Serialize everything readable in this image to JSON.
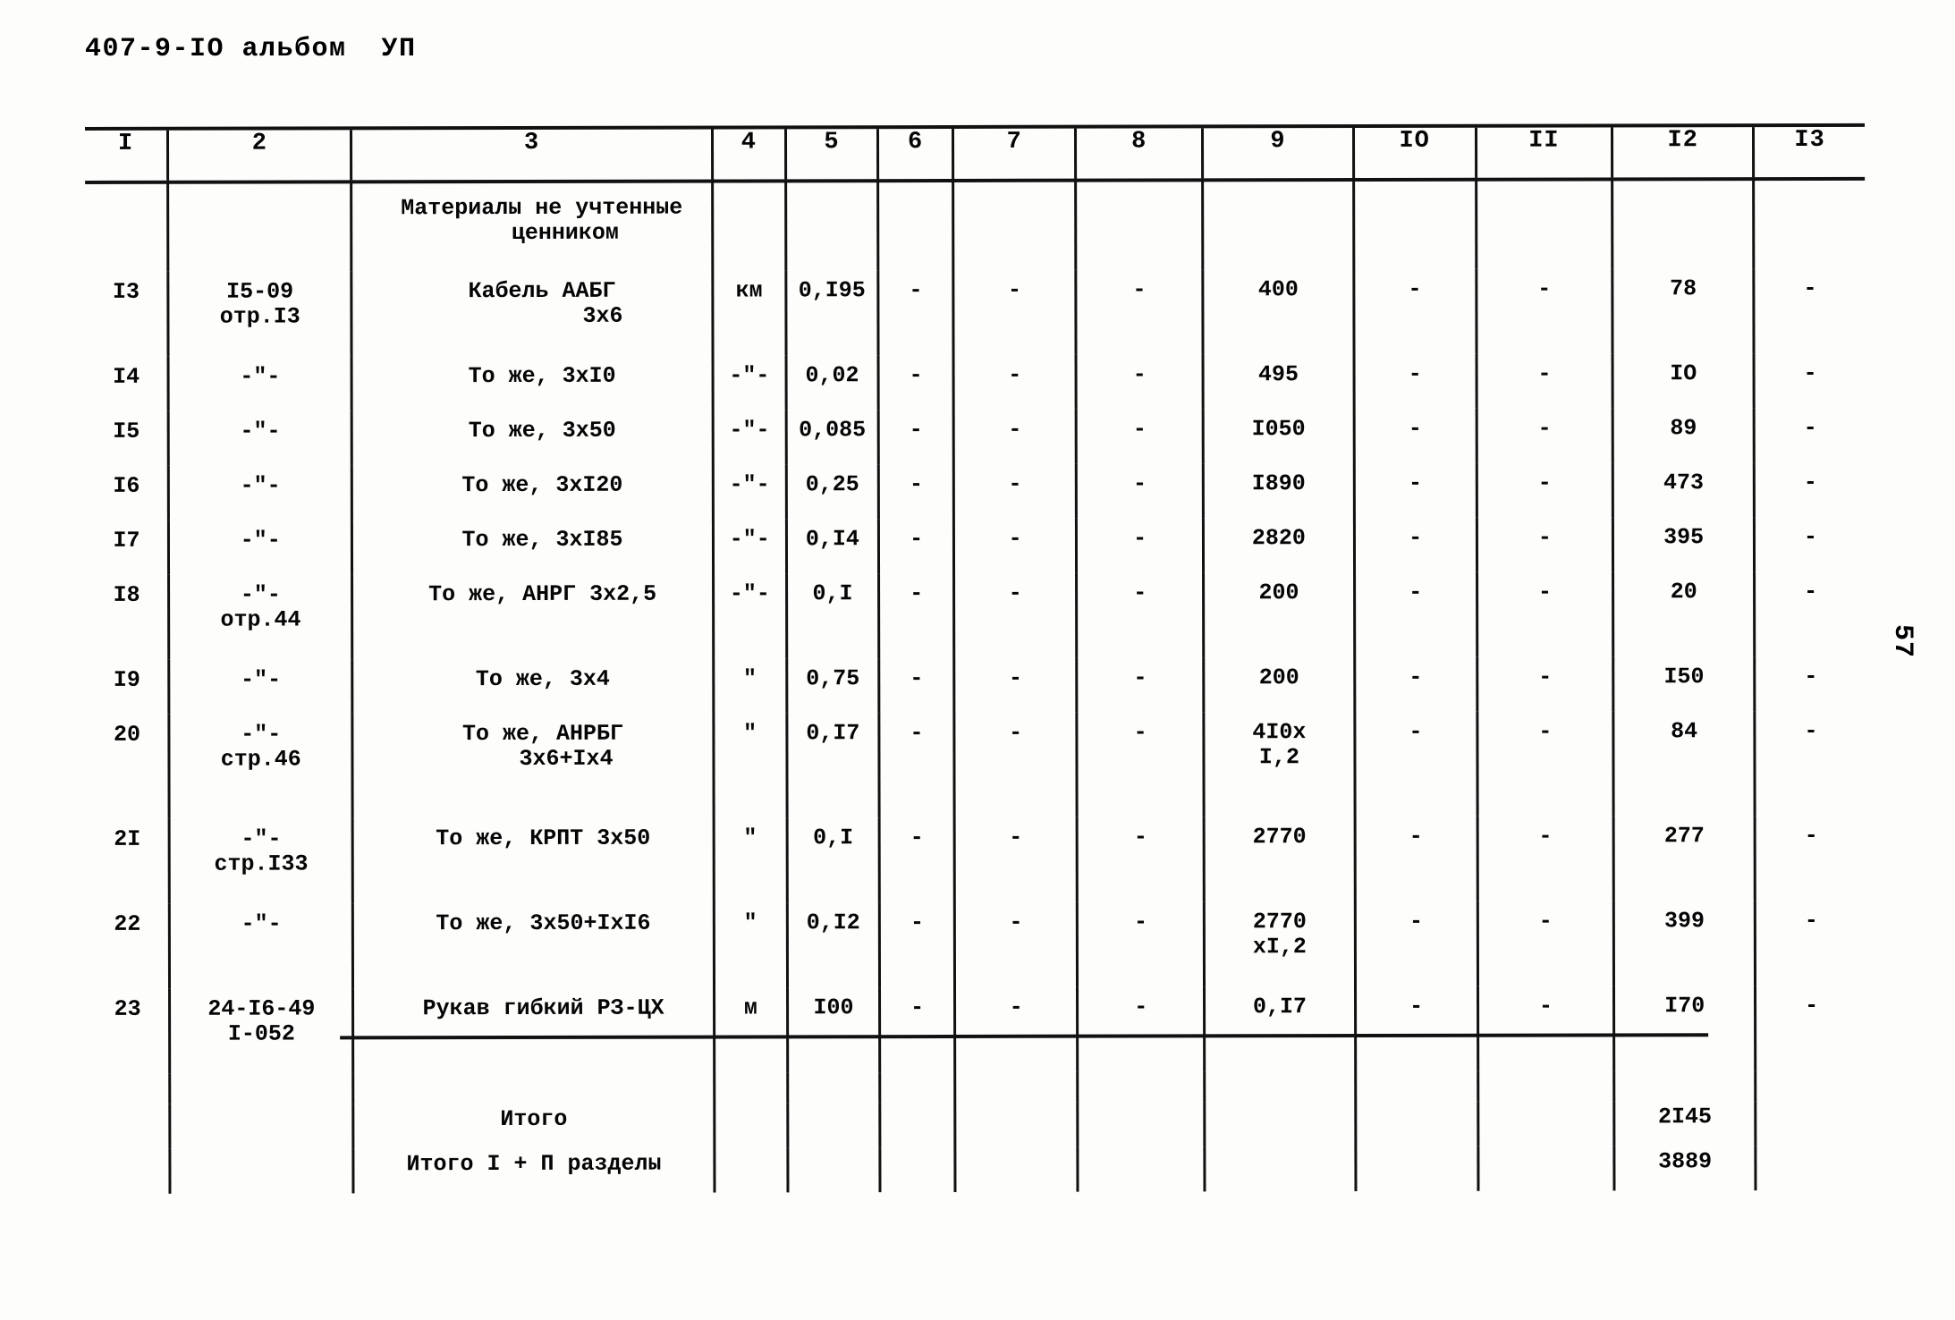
{
  "document": {
    "header": "407-9-IO альбом  УП",
    "page_number": "57"
  },
  "table": {
    "column_headers": [
      "I",
      "2",
      "3",
      "4",
      "5",
      "6",
      "7",
      "8",
      "9",
      "IO",
      "II",
      "I2",
      "I3"
    ],
    "section_note": {
      "line1": "Материалы не учтенные",
      "line2": "ценником"
    },
    "rows": [
      {
        "num": "I3",
        "code_line1": "I5-09",
        "code_line2": "отр.I3",
        "name_line1": "Кабель ААБГ",
        "name_line2": "3х6",
        "unit": "км",
        "qty": "0,I95",
        "c6": "-",
        "c7": "-",
        "c8": "-",
        "c9": "400",
        "c9b": "",
        "c10": "-",
        "c11": "-",
        "c12": "78",
        "c13": "-"
      },
      {
        "num": "I4",
        "code_line1": "-\"-",
        "code_line2": "",
        "name_line1": "То же, 3хI0",
        "name_line2": "",
        "unit": "-\"-",
        "qty": "0,02",
        "c6": "-",
        "c7": "-",
        "c8": "-",
        "c9": "495",
        "c9b": "",
        "c10": "-",
        "c11": "-",
        "c12": "IO",
        "c13": "-"
      },
      {
        "num": "I5",
        "code_line1": "-\"-",
        "code_line2": "",
        "name_line1": "То же, 3х50",
        "name_line2": "",
        "unit": "-\"-",
        "qty": "0,085",
        "c6": "-",
        "c7": "-",
        "c8": "-",
        "c9": "I050",
        "c9b": "",
        "c10": "-",
        "c11": "-",
        "c12": "89",
        "c13": "-"
      },
      {
        "num": "I6",
        "code_line1": "-\"-",
        "code_line2": "",
        "name_line1": "То же, 3хI20",
        "name_line2": "",
        "unit": "-\"-",
        "qty": "0,25",
        "c6": "-",
        "c7": "-",
        "c8": "-",
        "c9": "I890",
        "c9b": "",
        "c10": "-",
        "c11": "-",
        "c12": "473",
        "c13": "-"
      },
      {
        "num": "I7",
        "code_line1": "-\"-",
        "code_line2": "",
        "name_line1": "То же, 3хI85",
        "name_line2": "",
        "unit": "-\"-",
        "qty": "0,I4",
        "c6": "-",
        "c7": "-",
        "c8": "-",
        "c9": "2820",
        "c9b": "",
        "c10": "-",
        "c11": "-",
        "c12": "395",
        "c13": "-"
      },
      {
        "num": "I8",
        "code_line1": "-\"-",
        "code_line2": "отр.44",
        "name_line1": "То же, АНРГ 3х2,5",
        "name_line2": "",
        "unit": "-\"-",
        "qty": "0,I",
        "c6": "-",
        "c7": "-",
        "c8": "-",
        "c9": "200",
        "c9b": "",
        "c10": "-",
        "c11": "-",
        "c12": "20",
        "c13": "-"
      },
      {
        "num": "I9",
        "code_line1": "-\"-",
        "code_line2": "",
        "name_line1": "То же, 3х4",
        "name_line2": "",
        "unit": "\"",
        "qty": "0,75",
        "c6": "-",
        "c7": "-",
        "c8": "-",
        "c9": "200",
        "c9b": "",
        "c10": "-",
        "c11": "-",
        "c12": "I50",
        "c13": "-"
      },
      {
        "num": "20",
        "code_line1": "-\"-",
        "code_line2": "стр.46",
        "name_line1": "То же, АНРБГ",
        "name_line2": "3х6+Iх4",
        "unit": "\"",
        "qty": "0,I7",
        "c6": "-",
        "c7": "-",
        "c8": "-",
        "c9": "4I0х",
        "c9b": "I,2",
        "c10": "-",
        "c11": "-",
        "c12": "84",
        "c13": "-"
      },
      {
        "num": "2I",
        "code_line1": "-\"-",
        "code_line2": "стр.I33",
        "name_line1": "То же, КРПТ 3х50",
        "name_line2": "",
        "unit": "\"",
        "qty": "0,I",
        "c6": "-",
        "c7": "-",
        "c8": "-",
        "c9": "2770",
        "c9b": "",
        "c10": "-",
        "c11": "-",
        "c12": "277",
        "c13": "-"
      },
      {
        "num": "22",
        "code_line1": "-\"-",
        "code_line2": "",
        "name_line1": "То же, 3х50+IхI6",
        "name_line2": "",
        "unit": "\"",
        "qty": "0,I2",
        "c6": "-",
        "c7": "-",
        "c8": "-",
        "c9": "2770",
        "c9b": "хI,2",
        "c10": "-",
        "c11": "-",
        "c12": "399",
        "c13": "-"
      },
      {
        "num": "23",
        "code_line1": "24-I6-49",
        "code_line2": "I-052",
        "name_line1": "Рукав гибкий РЗ-ЦХ",
        "name_line2": "",
        "unit": "м",
        "qty": "I00",
        "c6": "-",
        "c7": "-",
        "c8": "-",
        "c9": "0,I7",
        "c9b": "",
        "c10": "-",
        "c11": "-",
        "c12": "I70",
        "c13": "-"
      }
    ],
    "totals": [
      {
        "label": "Итого",
        "value": "2I45"
      },
      {
        "label": "Итого I + П разделы",
        "value": "3889"
      }
    ]
  }
}
